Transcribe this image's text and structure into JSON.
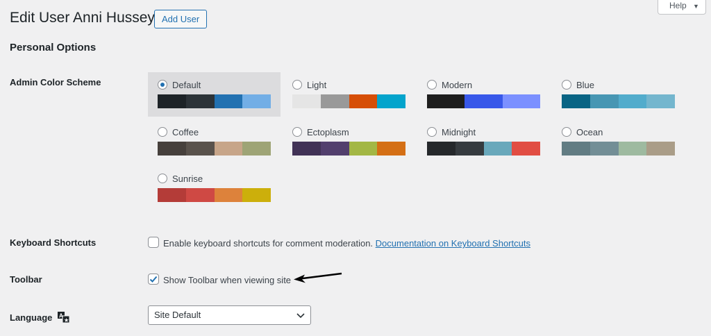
{
  "header": {
    "title": "Edit User Anni Hussey",
    "add_user": "Add User",
    "help": "Help"
  },
  "section_title": "Personal Options",
  "color_scheme": {
    "label": "Admin Color Scheme",
    "selected": "Default",
    "schemes": [
      {
        "name": "Default",
        "colors": [
          "#1d2327",
          "#2c3338",
          "#2271b1",
          "#72aee6"
        ]
      },
      {
        "name": "Light",
        "colors": [
          "#e5e5e5",
          "#999999",
          "#d64e07",
          "#04a4cc"
        ]
      },
      {
        "name": "Modern",
        "colors": [
          "#1e1e1e",
          "#3858e9",
          "#7b90ff"
        ]
      },
      {
        "name": "Blue",
        "colors": [
          "#096484",
          "#4796b3",
          "#52accc",
          "#74b6ce"
        ]
      },
      {
        "name": "Coffee",
        "colors": [
          "#46403c",
          "#59524c",
          "#c7a589",
          "#9ea476"
        ]
      },
      {
        "name": "Ectoplasm",
        "colors": [
          "#413256",
          "#523f6d",
          "#a3b745",
          "#d46f15"
        ]
      },
      {
        "name": "Midnight",
        "colors": [
          "#25282b",
          "#363b3f",
          "#69a8bb",
          "#e14d43"
        ]
      },
      {
        "name": "Ocean",
        "colors": [
          "#627c83",
          "#738e96",
          "#9ebaa0",
          "#aa9d88"
        ]
      },
      {
        "name": "Sunrise",
        "colors": [
          "#b43c38",
          "#cf4944",
          "#dd823b",
          "#ccaf0b"
        ]
      }
    ]
  },
  "keyboard": {
    "label": "Keyboard Shortcuts",
    "text": "Enable keyboard shortcuts for comment moderation.",
    "link": "Documentation on Keyboard Shortcuts",
    "checked": false
  },
  "toolbar": {
    "label": "Toolbar",
    "text": "Show Toolbar when viewing site",
    "checked": true
  },
  "language": {
    "label": "Language",
    "value": "Site Default"
  }
}
